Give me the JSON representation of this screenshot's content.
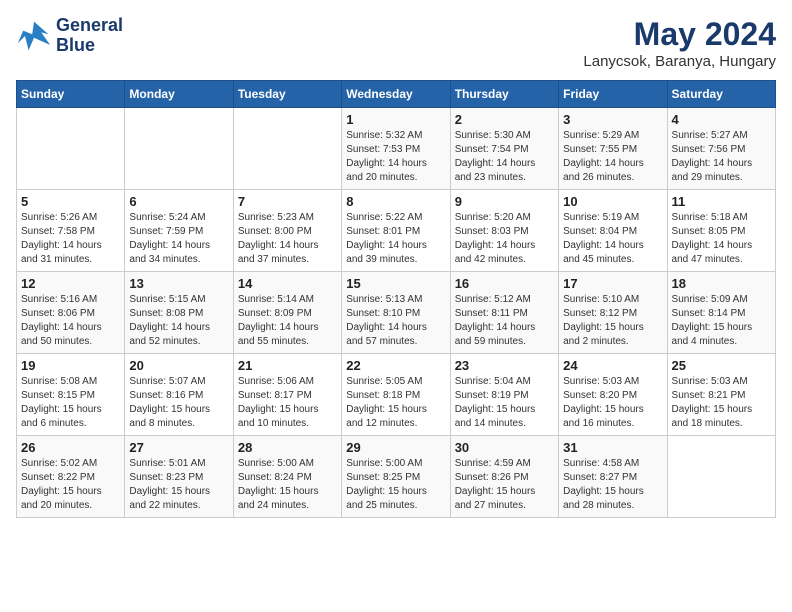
{
  "header": {
    "logo": {
      "line1": "General",
      "line2": "Blue"
    },
    "month": "May 2024",
    "location": "Lanycsok, Baranya, Hungary"
  },
  "weekdays": [
    "Sunday",
    "Monday",
    "Tuesday",
    "Wednesday",
    "Thursday",
    "Friday",
    "Saturday"
  ],
  "weeks": [
    [
      {
        "day": "",
        "info": ""
      },
      {
        "day": "",
        "info": ""
      },
      {
        "day": "",
        "info": ""
      },
      {
        "day": "1",
        "info": "Sunrise: 5:32 AM\nSunset: 7:53 PM\nDaylight: 14 hours\nand 20 minutes."
      },
      {
        "day": "2",
        "info": "Sunrise: 5:30 AM\nSunset: 7:54 PM\nDaylight: 14 hours\nand 23 minutes."
      },
      {
        "day": "3",
        "info": "Sunrise: 5:29 AM\nSunset: 7:55 PM\nDaylight: 14 hours\nand 26 minutes."
      },
      {
        "day": "4",
        "info": "Sunrise: 5:27 AM\nSunset: 7:56 PM\nDaylight: 14 hours\nand 29 minutes."
      }
    ],
    [
      {
        "day": "5",
        "info": "Sunrise: 5:26 AM\nSunset: 7:58 PM\nDaylight: 14 hours\nand 31 minutes."
      },
      {
        "day": "6",
        "info": "Sunrise: 5:24 AM\nSunset: 7:59 PM\nDaylight: 14 hours\nand 34 minutes."
      },
      {
        "day": "7",
        "info": "Sunrise: 5:23 AM\nSunset: 8:00 PM\nDaylight: 14 hours\nand 37 minutes."
      },
      {
        "day": "8",
        "info": "Sunrise: 5:22 AM\nSunset: 8:01 PM\nDaylight: 14 hours\nand 39 minutes."
      },
      {
        "day": "9",
        "info": "Sunrise: 5:20 AM\nSunset: 8:03 PM\nDaylight: 14 hours\nand 42 minutes."
      },
      {
        "day": "10",
        "info": "Sunrise: 5:19 AM\nSunset: 8:04 PM\nDaylight: 14 hours\nand 45 minutes."
      },
      {
        "day": "11",
        "info": "Sunrise: 5:18 AM\nSunset: 8:05 PM\nDaylight: 14 hours\nand 47 minutes."
      }
    ],
    [
      {
        "day": "12",
        "info": "Sunrise: 5:16 AM\nSunset: 8:06 PM\nDaylight: 14 hours\nand 50 minutes."
      },
      {
        "day": "13",
        "info": "Sunrise: 5:15 AM\nSunset: 8:08 PM\nDaylight: 14 hours\nand 52 minutes."
      },
      {
        "day": "14",
        "info": "Sunrise: 5:14 AM\nSunset: 8:09 PM\nDaylight: 14 hours\nand 55 minutes."
      },
      {
        "day": "15",
        "info": "Sunrise: 5:13 AM\nSunset: 8:10 PM\nDaylight: 14 hours\nand 57 minutes."
      },
      {
        "day": "16",
        "info": "Sunrise: 5:12 AM\nSunset: 8:11 PM\nDaylight: 14 hours\nand 59 minutes."
      },
      {
        "day": "17",
        "info": "Sunrise: 5:10 AM\nSunset: 8:12 PM\nDaylight: 15 hours\nand 2 minutes."
      },
      {
        "day": "18",
        "info": "Sunrise: 5:09 AM\nSunset: 8:14 PM\nDaylight: 15 hours\nand 4 minutes."
      }
    ],
    [
      {
        "day": "19",
        "info": "Sunrise: 5:08 AM\nSunset: 8:15 PM\nDaylight: 15 hours\nand 6 minutes."
      },
      {
        "day": "20",
        "info": "Sunrise: 5:07 AM\nSunset: 8:16 PM\nDaylight: 15 hours\nand 8 minutes."
      },
      {
        "day": "21",
        "info": "Sunrise: 5:06 AM\nSunset: 8:17 PM\nDaylight: 15 hours\nand 10 minutes."
      },
      {
        "day": "22",
        "info": "Sunrise: 5:05 AM\nSunset: 8:18 PM\nDaylight: 15 hours\nand 12 minutes."
      },
      {
        "day": "23",
        "info": "Sunrise: 5:04 AM\nSunset: 8:19 PM\nDaylight: 15 hours\nand 14 minutes."
      },
      {
        "day": "24",
        "info": "Sunrise: 5:03 AM\nSunset: 8:20 PM\nDaylight: 15 hours\nand 16 minutes."
      },
      {
        "day": "25",
        "info": "Sunrise: 5:03 AM\nSunset: 8:21 PM\nDaylight: 15 hours\nand 18 minutes."
      }
    ],
    [
      {
        "day": "26",
        "info": "Sunrise: 5:02 AM\nSunset: 8:22 PM\nDaylight: 15 hours\nand 20 minutes."
      },
      {
        "day": "27",
        "info": "Sunrise: 5:01 AM\nSunset: 8:23 PM\nDaylight: 15 hours\nand 22 minutes."
      },
      {
        "day": "28",
        "info": "Sunrise: 5:00 AM\nSunset: 8:24 PM\nDaylight: 15 hours\nand 24 minutes."
      },
      {
        "day": "29",
        "info": "Sunrise: 5:00 AM\nSunset: 8:25 PM\nDaylight: 15 hours\nand 25 minutes."
      },
      {
        "day": "30",
        "info": "Sunrise: 4:59 AM\nSunset: 8:26 PM\nDaylight: 15 hours\nand 27 minutes."
      },
      {
        "day": "31",
        "info": "Sunrise: 4:58 AM\nSunset: 8:27 PM\nDaylight: 15 hours\nand 28 minutes."
      },
      {
        "day": "",
        "info": ""
      }
    ]
  ]
}
